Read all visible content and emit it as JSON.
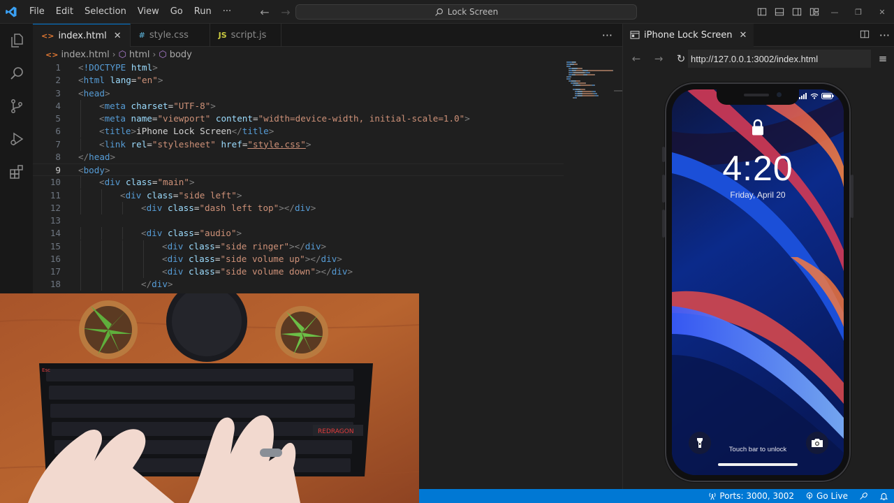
{
  "titlebar": {
    "menus": [
      "File",
      "Edit",
      "Selection",
      "View",
      "Go",
      "Run",
      "···"
    ],
    "search_text": "Lock Screen"
  },
  "tabs": [
    {
      "label": "index.html",
      "icon": "<>",
      "active": true
    },
    {
      "label": "style.css",
      "icon": "#",
      "active": false
    },
    {
      "label": "script.js",
      "icon": "JS",
      "active": false
    }
  ],
  "breadcrumb": [
    "index.html",
    "html",
    "body"
  ],
  "code_lines": [
    {
      "n": "1",
      "indent": 0,
      "tokens": [
        [
          "br",
          "<"
        ],
        [
          "tag",
          "!DOCTYPE"
        ],
        [
          "txt",
          " "
        ],
        [
          "attr",
          "html"
        ],
        [
          "br",
          ">"
        ]
      ]
    },
    {
      "n": "2",
      "indent": 0,
      "tokens": [
        [
          "br",
          "<"
        ],
        [
          "tag",
          "html"
        ],
        [
          "txt",
          " "
        ],
        [
          "attr",
          "lang"
        ],
        [
          "txt",
          "="
        ],
        [
          "str",
          "\"en\""
        ],
        [
          "br",
          ">"
        ]
      ]
    },
    {
      "n": "3",
      "indent": 0,
      "tokens": [
        [
          "br",
          "<"
        ],
        [
          "tag",
          "head"
        ],
        [
          "br",
          ">"
        ]
      ]
    },
    {
      "n": "4",
      "indent": 1,
      "tokens": [
        [
          "br",
          "<"
        ],
        [
          "tag",
          "meta"
        ],
        [
          "txt",
          " "
        ],
        [
          "attr",
          "charset"
        ],
        [
          "txt",
          "="
        ],
        [
          "str",
          "\"UTF-8\""
        ],
        [
          "br",
          ">"
        ]
      ]
    },
    {
      "n": "5",
      "indent": 1,
      "tokens": [
        [
          "br",
          "<"
        ],
        [
          "tag",
          "meta"
        ],
        [
          "txt",
          " "
        ],
        [
          "attr",
          "name"
        ],
        [
          "txt",
          "="
        ],
        [
          "str",
          "\"viewport\""
        ],
        [
          "txt",
          " "
        ],
        [
          "attr",
          "content"
        ],
        [
          "txt",
          "="
        ],
        [
          "str",
          "\"width=device-width, initial-scale=1.0\""
        ],
        [
          "br",
          ">"
        ]
      ]
    },
    {
      "n": "6",
      "indent": 1,
      "tokens": [
        [
          "br",
          "<"
        ],
        [
          "tag",
          "title"
        ],
        [
          "br",
          ">"
        ],
        [
          "txt",
          "iPhone Lock Screen"
        ],
        [
          "br",
          "</"
        ],
        [
          "tag",
          "title"
        ],
        [
          "br",
          ">"
        ]
      ]
    },
    {
      "n": "7",
      "indent": 1,
      "tokens": [
        [
          "br",
          "<"
        ],
        [
          "tag",
          "link"
        ],
        [
          "txt",
          " "
        ],
        [
          "attr",
          "rel"
        ],
        [
          "txt",
          "="
        ],
        [
          "str",
          "\"stylesheet\""
        ],
        [
          "txt",
          " "
        ],
        [
          "attr",
          "href"
        ],
        [
          "txt",
          "="
        ],
        [
          "url",
          "\"style.css\""
        ],
        [
          "br",
          ">"
        ]
      ]
    },
    {
      "n": "8",
      "indent": 0,
      "tokens": [
        [
          "br",
          "</"
        ],
        [
          "tag",
          "head"
        ],
        [
          "br",
          ">"
        ]
      ]
    },
    {
      "n": "9",
      "indent": 0,
      "tokens": [
        [
          "br",
          "<"
        ],
        [
          "tag",
          "body"
        ],
        [
          "br",
          ">"
        ]
      ]
    },
    {
      "n": "10",
      "indent": 1,
      "tokens": [
        [
          "br",
          "<"
        ],
        [
          "tag",
          "div"
        ],
        [
          "txt",
          " "
        ],
        [
          "attr",
          "class"
        ],
        [
          "txt",
          "="
        ],
        [
          "str",
          "\"main\""
        ],
        [
          "br",
          ">"
        ]
      ]
    },
    {
      "n": "11",
      "indent": 2,
      "tokens": [
        [
          "br",
          "<"
        ],
        [
          "tag",
          "div"
        ],
        [
          "txt",
          " "
        ],
        [
          "attr",
          "class"
        ],
        [
          "txt",
          "="
        ],
        [
          "str",
          "\"side left\""
        ],
        [
          "br",
          ">"
        ]
      ]
    },
    {
      "n": "12",
      "indent": 3,
      "tokens": [
        [
          "br",
          "<"
        ],
        [
          "tag",
          "div"
        ],
        [
          "txt",
          " "
        ],
        [
          "attr",
          "class"
        ],
        [
          "txt",
          "="
        ],
        [
          "str",
          "\"dash left top\""
        ],
        [
          "br",
          "></"
        ],
        [
          "tag",
          "div"
        ],
        [
          "br",
          ">"
        ]
      ]
    },
    {
      "n": "13",
      "indent": 0,
      "tokens": []
    },
    {
      "n": "14",
      "indent": 3,
      "tokens": [
        [
          "br",
          "<"
        ],
        [
          "tag",
          "div"
        ],
        [
          "txt",
          " "
        ],
        [
          "attr",
          "class"
        ],
        [
          "txt",
          "="
        ],
        [
          "str",
          "\"audio\""
        ],
        [
          "br",
          ">"
        ]
      ]
    },
    {
      "n": "15",
      "indent": 4,
      "tokens": [
        [
          "br",
          "<"
        ],
        [
          "tag",
          "div"
        ],
        [
          "txt",
          " "
        ],
        [
          "attr",
          "class"
        ],
        [
          "txt",
          "="
        ],
        [
          "str",
          "\"side ringer\""
        ],
        [
          "br",
          "></"
        ],
        [
          "tag",
          "div"
        ],
        [
          "br",
          ">"
        ]
      ]
    },
    {
      "n": "16",
      "indent": 4,
      "tokens": [
        [
          "br",
          "<"
        ],
        [
          "tag",
          "div"
        ],
        [
          "txt",
          " "
        ],
        [
          "attr",
          "class"
        ],
        [
          "txt",
          "="
        ],
        [
          "str",
          "\"side volume up\""
        ],
        [
          "br",
          "></"
        ],
        [
          "tag",
          "div"
        ],
        [
          "br",
          ">"
        ]
      ]
    },
    {
      "n": "17",
      "indent": 4,
      "tokens": [
        [
          "br",
          "<"
        ],
        [
          "tag",
          "div"
        ],
        [
          "txt",
          " "
        ],
        [
          "attr",
          "class"
        ],
        [
          "txt",
          "="
        ],
        [
          "str",
          "\"side volume down\""
        ],
        [
          "br",
          "></"
        ],
        [
          "tag",
          "div"
        ],
        [
          "br",
          ">"
        ]
      ]
    },
    {
      "n": "18",
      "indent": 3,
      "tokens": [
        [
          "br",
          "</"
        ],
        [
          "tag",
          "div"
        ],
        [
          "br",
          ">"
        ]
      ]
    }
  ],
  "current_line": "9",
  "preview": {
    "tab_title": "iPhone Lock Screen",
    "url": "http://127.0.0.1:3002/index.html"
  },
  "lockscreen": {
    "time": "4:20",
    "date": "Friday, April 20",
    "unlock_hint": "Touch bar to unlock"
  },
  "statusbar": {
    "ports": "Ports: 3000, 3002",
    "golive": "Go Live"
  },
  "colors": {
    "accent": "#0078d4",
    "editor_bg": "#1f1f1f",
    "tag": "#569cd6",
    "attr": "#9cdcfe",
    "string": "#ce9178"
  }
}
